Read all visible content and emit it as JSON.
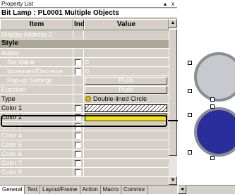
{
  "panel": {
    "title": "Property List",
    "title_controls": [
      "▴",
      "x"
    ],
    "object_title": "Bit Lamp : PL0001 Multiple Objects",
    "columns": [
      "Item",
      "Ind",
      "Value"
    ],
    "rows": [
      {
        "label": "Display Address 2"
      },
      {
        "label": "Style"
      },
      {
        "label": "Action"
      },
      {
        "label": "Set Value",
        "value": "0"
      },
      {
        "label": "Increment/Decreme",
        "value": "0"
      },
      {
        "label": "Pop-up Settings",
        "button": "Push"
      },
      {
        "label": "Function",
        "button": "Push"
      },
      {
        "label": "Type",
        "value": "Double-lined Circle"
      },
      {
        "label": "Color 1"
      },
      {
        "label": "Color 2"
      },
      {
        "label": "Color 3"
      },
      {
        "label": "Color 4"
      },
      {
        "label": "Color 5"
      },
      {
        "label": "Color 6"
      },
      {
        "label": "Color 7"
      },
      {
        "label": "Color 8"
      }
    ],
    "tabs": [
      "General",
      "Text",
      "Layout/Frame",
      "Action",
      "Macro",
      "Commor"
    ]
  },
  "colors": {
    "color1": "hatched-white",
    "color2": "#f5e50a",
    "lamp_top": "#c8c9cf",
    "lamp_bottom": "#2a2d9c"
  },
  "icons": {
    "scroll_up": "▲",
    "scroll_down": "▼",
    "scroll_left": "◄"
  }
}
